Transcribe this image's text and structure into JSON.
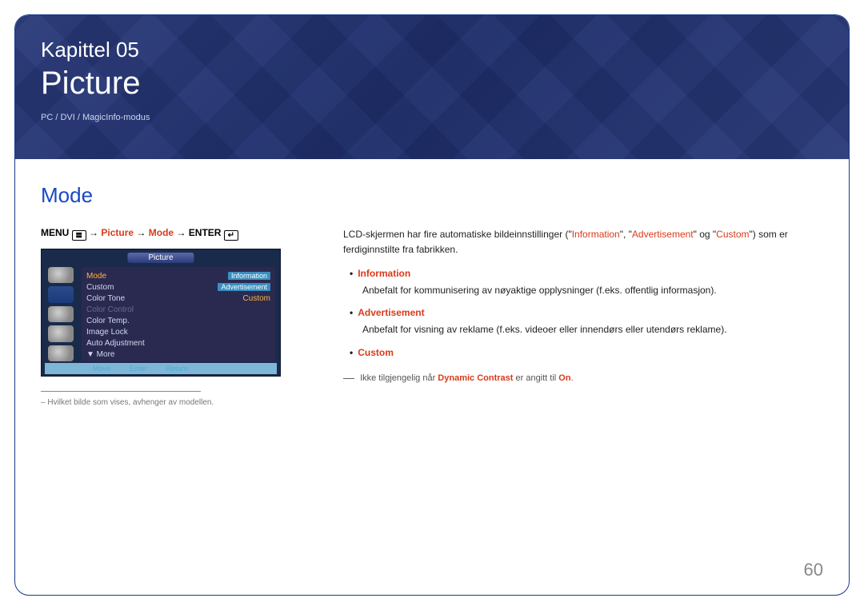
{
  "hero": {
    "chapter": "Kapittel 05",
    "title": "Picture",
    "subtitle": "PC / DVI / MagicInfo-modus"
  },
  "section": {
    "title": "Mode"
  },
  "breadcrumb": {
    "menu": "MENU",
    "arrow": " → ",
    "picture": "Picture",
    "mode": "Mode",
    "enter": "ENTER"
  },
  "osd": {
    "title": "Picture",
    "rows": [
      {
        "label": "Mode",
        "value": "Information",
        "selected": true,
        "valueHighlight": true
      },
      {
        "label": "Custom",
        "value": "Advertisement",
        "valueHighlight": true
      },
      {
        "label": "Color Tone",
        "value": "Custom",
        "valueOrange": true
      },
      {
        "label": "Color Control",
        "value": "",
        "dim": true
      },
      {
        "label": "Color Temp.",
        "value": ""
      },
      {
        "label": "Image Lock",
        "value": ""
      },
      {
        "label": "Auto Adjustment",
        "value": ""
      }
    ],
    "more": "▼ More",
    "footer": {
      "move": "Move",
      "enter": "Enter",
      "return": "Return"
    }
  },
  "footnote": "Hvilket bilde som vises, avhenger av modellen.",
  "intro": {
    "pre": "LCD-skjermen har fire automatiske bildeinnstillinger (\"",
    "q1": "Information",
    "mid1": "\", \"",
    "q2": "Advertisement",
    "mid2": "\" og \"",
    "q3": "Custom",
    "post": "\") som er ferdiginnstilte fra fabrikken."
  },
  "items": [
    {
      "name": "Information",
      "body": "Anbefalt for kommunisering av nøyaktige opplysninger (f.eks. offentlig informasjon)."
    },
    {
      "name": "Advertisement",
      "body": "Anbefalt for visning av reklame (f.eks. videoer eller innendørs eller utendørs reklame)."
    },
    {
      "name": "Custom",
      "body": ""
    }
  ],
  "note": {
    "pre": "Ikke tilgjengelig når ",
    "dc": "Dynamic Contrast",
    "mid": " er angitt til ",
    "on": "On",
    "post": "."
  },
  "pageNumber": "60"
}
